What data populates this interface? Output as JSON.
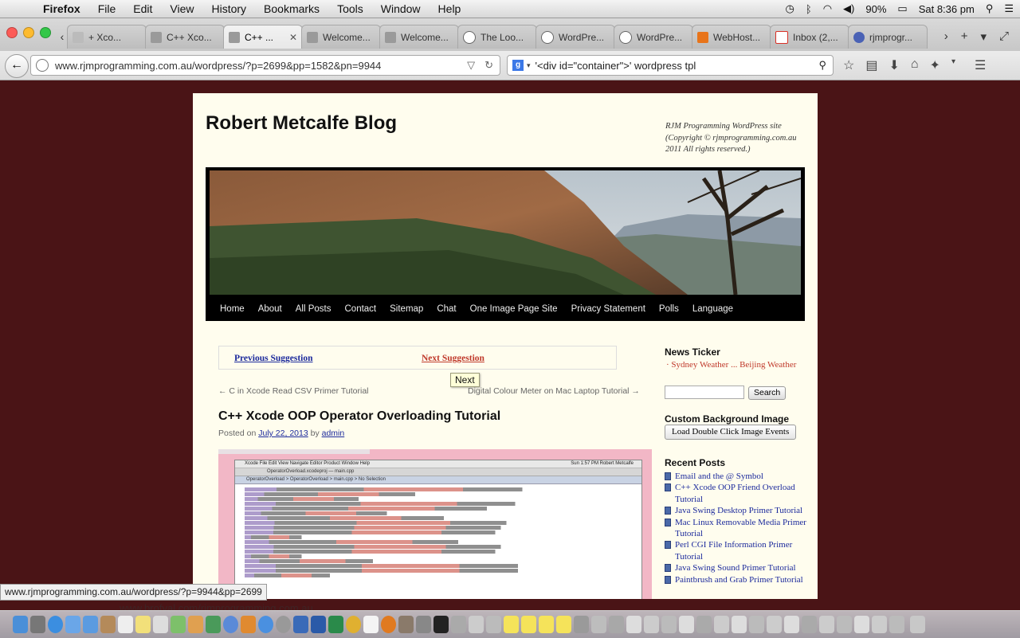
{
  "menubar": {
    "app": "Firefox",
    "items": [
      "File",
      "Edit",
      "View",
      "History",
      "Bookmarks",
      "Tools",
      "Window",
      "Help"
    ],
    "battery": "90%",
    "clock": "Sat 8:36 pm"
  },
  "tabs": [
    {
      "label": "+ Xco...",
      "active": false
    },
    {
      "label": "C++ Xco...",
      "active": false
    },
    {
      "label": "C++ ...",
      "active": true
    },
    {
      "label": "Welcome...",
      "active": false
    },
    {
      "label": "Welcome...",
      "active": false
    },
    {
      "label": "The Loo...",
      "active": false
    },
    {
      "label": "WordPre...",
      "active": false
    },
    {
      "label": "WordPre...",
      "active": false
    },
    {
      "label": "WebHost...",
      "active": false
    },
    {
      "label": "Inbox (2,...",
      "active": false
    },
    {
      "label": "rjmprogr...",
      "active": false
    }
  ],
  "navbar": {
    "url": "www.rjmprogramming.com.au/wordpress/?p=2699&pp=1582&pn=9944",
    "search_value": "'<div id=\"container\">' wordpress tpl"
  },
  "site": {
    "title": "Robert Metcalfe Blog",
    "description": "RJM Programming WordPress site (Copyright © rjmprogramming.com.au 2011 All rights reserved.)",
    "nav": [
      "Home",
      "About",
      "All Posts",
      "Contact",
      "Sitemap",
      "Chat",
      "One Image Page Site",
      "Privacy Statement",
      "Polls",
      "Language"
    ]
  },
  "suggestion": {
    "previous": "Previous Suggestion",
    "next": "Next Suggestion",
    "tooltip": "Next"
  },
  "postnav": {
    "prev": "← C in Xcode Read CSV Primer Tutorial",
    "next": "Digital Colour Meter on Mac Laptop Tutorial →"
  },
  "post": {
    "title": "C++ Xcode OOP Operator Overloading Tutorial",
    "posted_on": "Posted on",
    "date": "July 22, 2013",
    "by": "by",
    "author": "admin",
    "screenshot_menu": "Xcode   File   Edit   View   Navigate   Editor   Product   Window   Help",
    "screenshot_title": "OperatorOverload.xcodeproj — main.cpp",
    "screenshot_path": "OperatorOverload  >  OperatorOverload  >  main.cpp  >  No Selection",
    "screenshot_clock": "Sun 1:57 PM   Robert Metcalfe"
  },
  "sidebar": {
    "news_heading": "News Ticker",
    "news_items": "· Sydney Weather ... Beijing Weather",
    "search_button": "Search",
    "bg_heading": "Custom Background Image",
    "bg_button": "Load Double Click Image Events",
    "recent_heading": "Recent Posts",
    "recent_posts": [
      "Email and the @ Symbol",
      "C++ Xcode OOP Friend Overload Tutorial",
      "Java Swing Desktop Primer Tutorial",
      "Mac Linux Removable Media Primer Tutorial",
      "Perl CGI File Information Primer Tutorial",
      "Java Swing Sound Primer Tutorial",
      "Paintbrush and Grab Primer Tutorial"
    ]
  },
  "statusbar": "www.rjmprogramming.com.au/wordpress/?p=9944&pp=2699",
  "dock_link": "www.brofval.com/rjmprogramming.com.au",
  "colors": {
    "page_background": "#4a1416",
    "content_background": "#fffdee",
    "link_blue": "#1c2a9c",
    "accent_red": "#c0392b"
  }
}
